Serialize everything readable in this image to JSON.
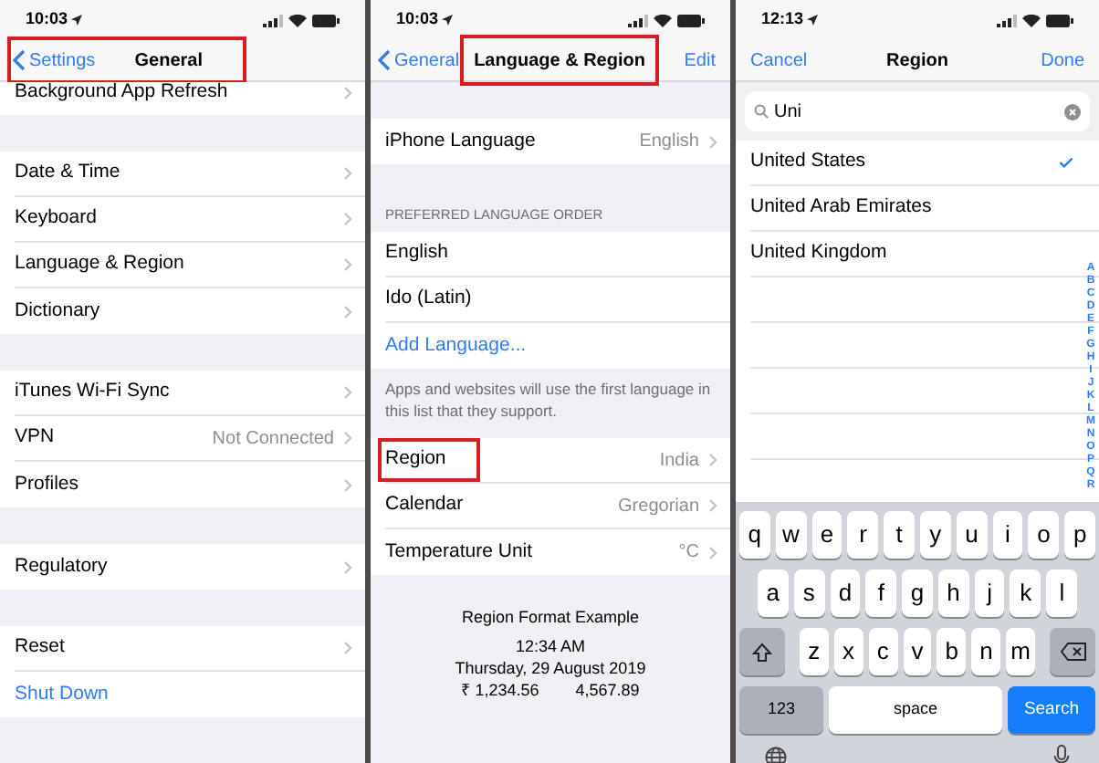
{
  "general": {
    "status_time": "10:03",
    "nav": {
      "back": "Settings",
      "title": "General",
      "highlighted": true,
      "highlight_covers_back": true
    },
    "list_scrolled": true,
    "groups": [
      {
        "rows": [
          {
            "label": "Background App Refresh",
            "kind": "nav"
          }
        ]
      },
      {
        "rows": [
          {
            "label": "Date & Time",
            "kind": "nav"
          },
          {
            "label": "Keyboard",
            "kind": "nav"
          },
          {
            "label": "Language & Region",
            "kind": "nav"
          },
          {
            "label": "Dictionary",
            "kind": "nav"
          }
        ]
      },
      {
        "rows": [
          {
            "label": "iTunes Wi-Fi Sync",
            "kind": "nav"
          },
          {
            "label": "VPN",
            "value": "Not Connected",
            "kind": "nav"
          },
          {
            "label": "Profiles",
            "kind": "nav"
          }
        ]
      },
      {
        "rows": [
          {
            "label": "Regulatory",
            "kind": "nav"
          }
        ]
      },
      {
        "rows": [
          {
            "label": "Reset",
            "kind": "nav"
          },
          {
            "label": "Shut Down",
            "kind": "link"
          }
        ]
      }
    ]
  },
  "language_region": {
    "status_time": "10:03",
    "nav": {
      "back": "General",
      "title": "Language & Region",
      "right": "Edit",
      "highlighted": true,
      "highlight_covers_back": false
    },
    "list_scrolled": false,
    "groups": [
      {
        "rows": [
          {
            "label": "iPhone Language",
            "value": "English",
            "kind": "nav",
            "highlighted": false
          }
        ]
      },
      {
        "header": "PREFERRED LANGUAGE ORDER",
        "rows": [
          {
            "label": "English",
            "kind": "plain",
            "highlighted": false
          },
          {
            "label": "Ido (Latin)",
            "kind": "plain",
            "highlighted": false
          },
          {
            "label": "Add Language...",
            "kind": "link",
            "highlighted": false
          }
        ],
        "footer": "Apps and websites will use the first language in this list that they support."
      },
      {
        "rows": [
          {
            "label": "Region",
            "value": "India",
            "kind": "nav",
            "highlighted": true
          },
          {
            "label": "Calendar",
            "value": "Gregorian",
            "kind": "nav",
            "highlighted": false
          },
          {
            "label": "Temperature Unit",
            "value": "°C",
            "kind": "nav",
            "highlighted": false
          }
        ]
      }
    ],
    "example": {
      "title": "Region Format Example",
      "lines": [
        "12:34 AM",
        "Thursday, 29 August 2019"
      ],
      "amounts": [
        "₹ 1,234.56",
        "4,567.89"
      ]
    }
  },
  "region_picker": {
    "status_time": "12:13",
    "nav": {
      "left": "Cancel",
      "title": "Region",
      "right": "Done"
    },
    "search": {
      "value": "Uni"
    },
    "results": [
      {
        "label": "United States",
        "selected": true
      },
      {
        "label": "United Arab Emirates",
        "selected": false
      },
      {
        "label": "United Kingdom",
        "selected": false
      }
    ],
    "index": [
      "A",
      "B",
      "C",
      "D",
      "E",
      "F",
      "G",
      "H",
      "I",
      "J",
      "K",
      "L",
      "M",
      "N",
      "O",
      "P",
      "Q",
      "R"
    ],
    "keyboard": {
      "rows": [
        [
          "q",
          "w",
          "e",
          "r",
          "t",
          "y",
          "u",
          "i",
          "o",
          "p"
        ],
        [
          "a",
          "s",
          "d",
          "f",
          "g",
          "h",
          "j",
          "k",
          "l"
        ],
        [
          "z",
          "x",
          "c",
          "v",
          "b",
          "n",
          "m"
        ]
      ],
      "numbers_key": "123",
      "space_key": "space",
      "action_key": "Search"
    }
  }
}
